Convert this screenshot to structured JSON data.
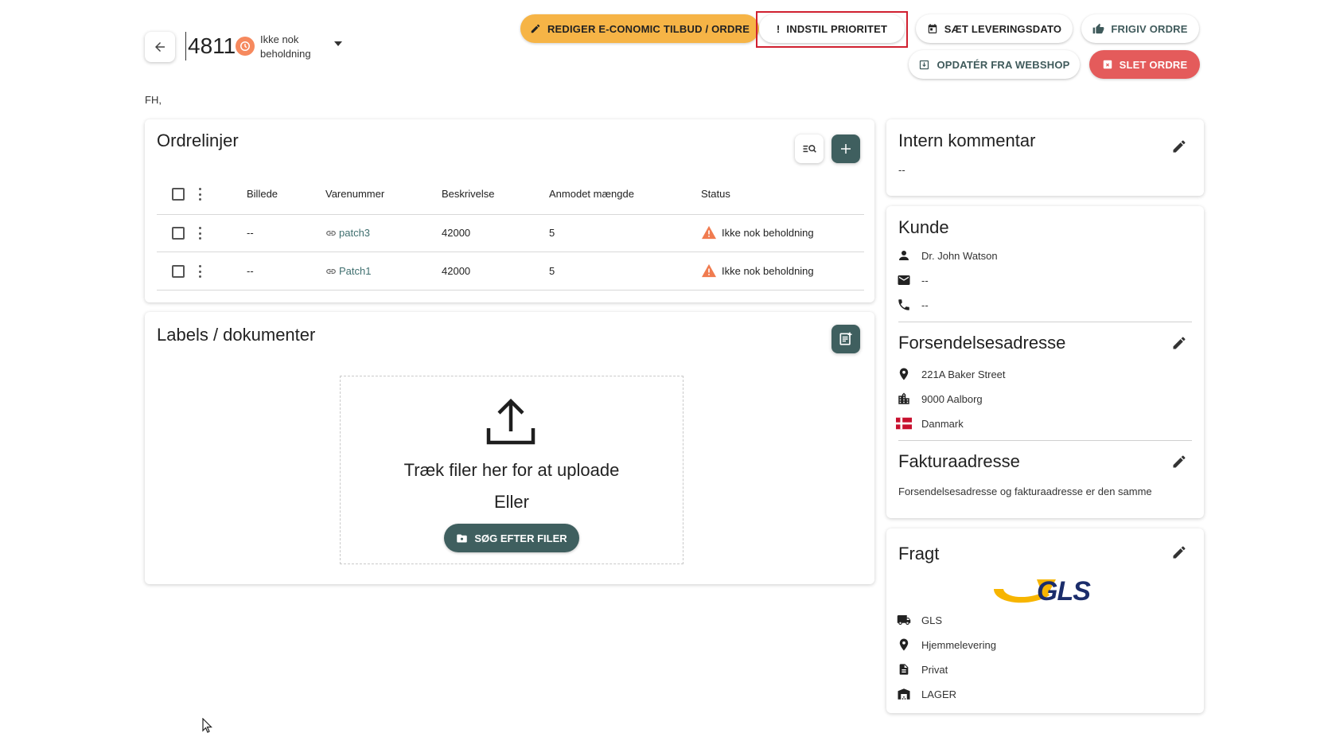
{
  "header": {
    "order_number": "4811",
    "status_text": "Ikke nok beholdning",
    "customer_short": "FH,"
  },
  "actions": {
    "edit_economic": "REDIGER E-CONOMIC TILBUD / ORDRE",
    "set_priority": "INDSTIL PRIORITET",
    "set_delivery_date": "SÆT LEVERINGSDATO",
    "release_order": "FRIGIV ORDRE",
    "update_from_webshop": "OPDATÉR FRA WEBSHOP",
    "delete_order": "SLET ORDRE"
  },
  "order_lines": {
    "title": "Ordrelinjer",
    "columns": [
      "Billede",
      "Varenummer",
      "Beskrivelse",
      "Anmodet mængde",
      "Status"
    ],
    "rows": [
      {
        "image": "--",
        "item_no": "patch3",
        "description": "42000",
        "qty": "5",
        "status": "Ikke nok beholdning"
      },
      {
        "image": "--",
        "item_no": "Patch1",
        "description": "42000",
        "qty": "5",
        "status": "Ikke nok beholdning"
      }
    ]
  },
  "documents": {
    "title": "Labels / dokumenter",
    "drop_text": "Træk filer her for at uploade",
    "or_text": "Eller",
    "browse_label": "SØG EFTER FILER"
  },
  "internal_comment": {
    "title": "Intern kommentar",
    "value": "--"
  },
  "customer": {
    "title": "Kunde",
    "name": "Dr. John Watson",
    "email": "--",
    "phone": "--"
  },
  "shipping_address": {
    "title": "Forsendelsesadresse",
    "street": "221A Baker Street",
    "city": "9000 Aalborg",
    "country": "Danmark"
  },
  "invoice_address": {
    "title": "Fakturaadresse",
    "note": "Forsendelsesadresse og fakturaadresse er den samme"
  },
  "freight": {
    "title": "Fragt",
    "logo_text": "GLS",
    "carrier": "GLS",
    "delivery_type": "Hjemmelevering",
    "customer_type": "Privat",
    "warehouse": "LAGER"
  },
  "colors": {
    "accent_teal": "#3f5f5f",
    "orange": "#f6b446",
    "danger": "#e45b5b",
    "status_orange": "#f6895e",
    "warn": "#f07b4f",
    "gls_blue": "#1b2d6b",
    "gls_yellow": "#f7b500"
  }
}
